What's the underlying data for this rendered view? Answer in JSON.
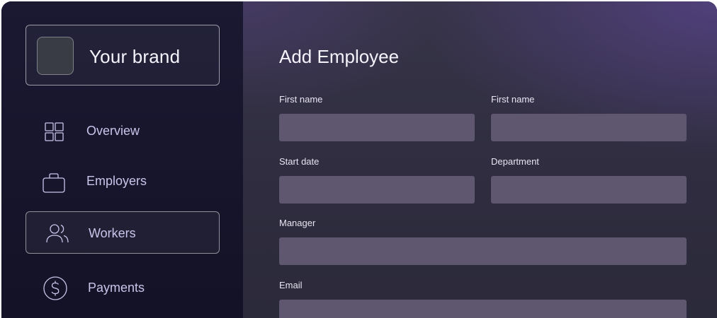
{
  "brand": {
    "name": "Your brand"
  },
  "sidebar": {
    "items": [
      {
        "label": "Overview",
        "icon": "grid-icon",
        "active": false
      },
      {
        "label": "Employers",
        "icon": "briefcase-icon",
        "active": false
      },
      {
        "label": "Workers",
        "icon": "users-icon",
        "active": true
      },
      {
        "label": "Payments",
        "icon": "dollar-circle-icon",
        "active": false
      }
    ]
  },
  "main": {
    "title": "Add Employee",
    "fields": {
      "first_name_1": {
        "label": "First name",
        "value": ""
      },
      "first_name_2": {
        "label": "First name",
        "value": ""
      },
      "start_date": {
        "label": "Start date",
        "value": ""
      },
      "department": {
        "label": "Department",
        "value": ""
      },
      "manager": {
        "label": "Manager",
        "value": ""
      },
      "email": {
        "label": "Email",
        "value": ""
      }
    }
  },
  "colors": {
    "sidebar_bg": "#15142a",
    "nav_text": "#c9c4ea",
    "input_bg": "#5f566f",
    "accent_purple": "#58448c"
  }
}
